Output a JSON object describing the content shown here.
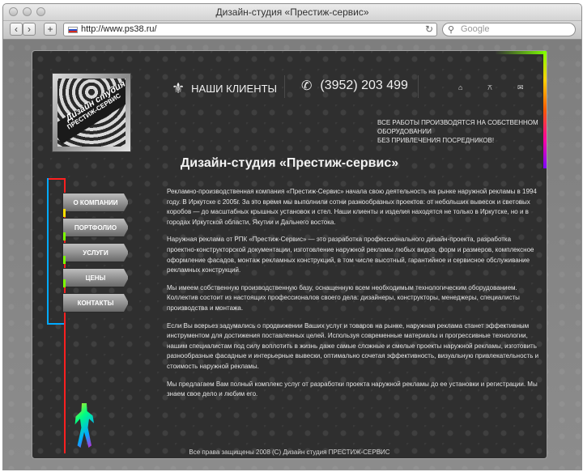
{
  "window": {
    "title": "Дизайн-студия «Престиж-сервис»"
  },
  "toolbar": {
    "back_icon": "chevron-left",
    "forward_icon": "chevron-right",
    "add_icon": "plus",
    "url": "http://www.ps38.ru/",
    "search_placeholder": "Google"
  },
  "header": {
    "logo": {
      "line1": "Дизайн студия",
      "line2": "ПРЕСТИЖ-СЕРВИС"
    },
    "clients_label": "НАШИ КЛИЕНТЫ",
    "phone": "(3952) 203 499",
    "icons": [
      "home-icon",
      "sitemap-icon",
      "mail-icon"
    ],
    "notice_line1": "ВСЕ РАБОТЫ ПРОИЗВОДЯТСЯ НА СОБСТВЕННОМ ОБОРУДОВАНИИ",
    "notice_line2": "БЕЗ ПРИВЛЕЧЕНИЯ ПОСРЕДНИКОВ!"
  },
  "menu": [
    {
      "label": "О КОМПАНИИ"
    },
    {
      "label": "ПОРТФОЛИО"
    },
    {
      "label": "УСЛУГИ"
    },
    {
      "label": "ЦЕНЫ"
    },
    {
      "label": "КОНТАКТЫ"
    }
  ],
  "main": {
    "title": "Дизайн-студия «Престиж-сервис»",
    "paragraphs": [
      "Рекламно-производственная компания «Престиж-Сервис» начала свою деятельность на рынке наружной рекламы в 1994 году. В Иркутске с 2005г. За это время мы выполнили сотни разнообразных проектов: от небольших вывесок и световых коробов — до масштабных крышных установок и стел. Наши клиенты и изделия находятся не только в Иркутске, но и в городах Иркутской области, Якутии и Дальнего востока.",
      "Наружная реклама от РПК «Престиж-Сервис» — это разработка профессионального дизайн-проекта, разработка проектно-конструкторской документации, изготовление наружной рекламы любых видов, форм и размеров, комплексное оформление фасадов, монтаж рекламных конструкций, в том числе высотный, гарантийное и сервисное обслуживание рекламных конструкций.",
      "Мы имеем собственную производственную базу, оснащенную всем необходимым технологическим оборудованием. Коллектив состоит из настоящих профессионалов своего дела: дизайнеры, конструкторы, менеджеры, специалисты производства и монтажа.",
      "Если Вы всерьез задумались о продвижении Ваших услуг и товаров на рынке, наружная реклама станет эффективным инструментом для достижения поставленных целей. Используя современные материалы и прогрессивные технологии, нашим специалистам под силу воплотить в жизнь даже самые сложные и смелые проекты наружной рекламы, изготовить разнообразные фасадные и интерьерные вывески, оптимально сочетая эффективность, визуальную привлекательность и стоимость наружной рекламы.",
      "Мы предлагаем Вам полный комплекс услуг от разработки проекта наружной рекламы до ее установки и регистрации. Мы знаем свое дело и любим его."
    ]
  },
  "footer": {
    "text": "Все права защищены 2008 (С) Дизайн студия ПРЕСТИЖ-СЕРВИС"
  },
  "colors": {
    "background": "#2f2f2f",
    "text": "#e6e6e6",
    "neon_red": "#ff2020",
    "neon_blue": "#00aaff",
    "neon_green": "#7cff00"
  }
}
